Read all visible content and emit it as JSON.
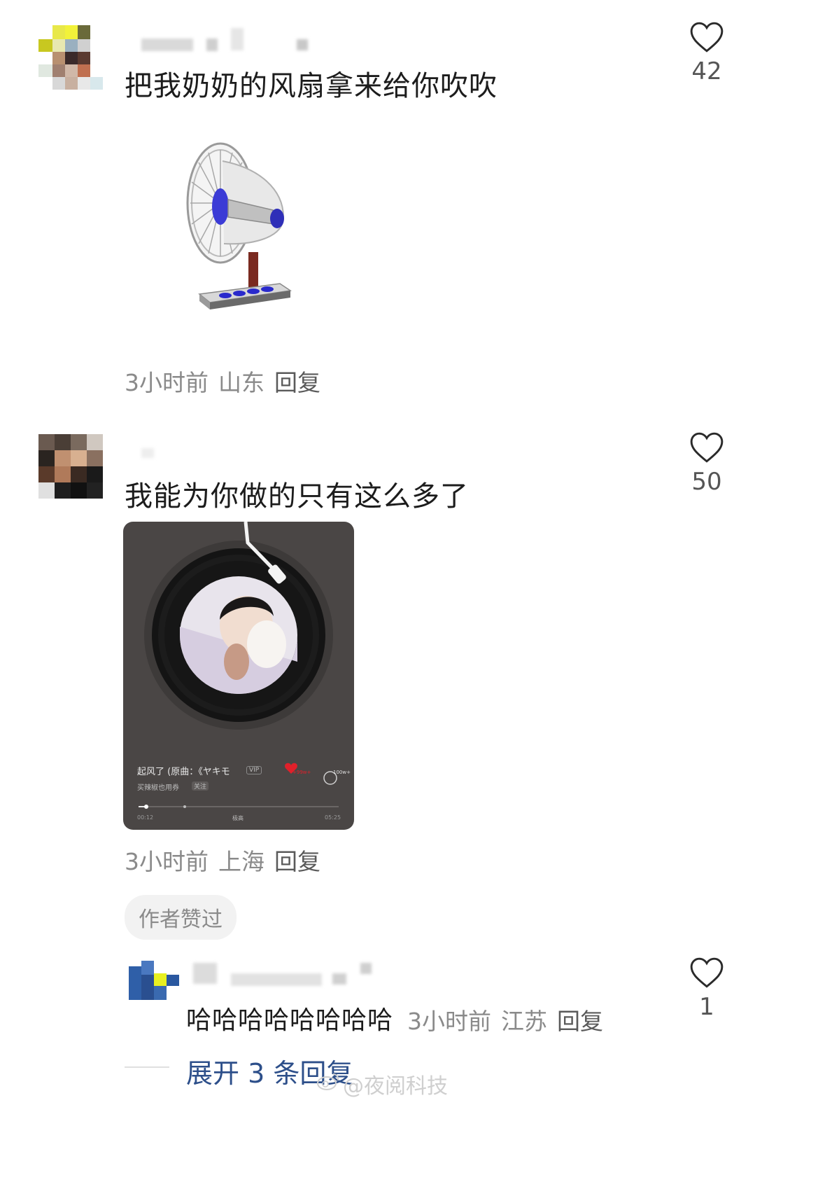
{
  "comments": [
    {
      "text": "把我奶奶的风扇拿来给你吹吹",
      "time": "3小时前",
      "location": "山东",
      "reply_label": "回复",
      "likes": "42"
    },
    {
      "text": "我能为你做的只有这么多了",
      "time": "3小时前",
      "location": "上海",
      "reply_label": "回复",
      "likes": "50",
      "badge": "作者赞过",
      "player": {
        "song_title": "起风了 (原曲：《ヤキモ",
        "vip": "VIP",
        "artist": "买辣椒也用券",
        "follow": "关注",
        "like_count": "+99w+",
        "comment_count": "100w+",
        "time_current": "00:12",
        "quality": "极高",
        "time_total": "05:25"
      }
    }
  ],
  "reply": {
    "text": "哈哈哈哈哈哈哈哈",
    "time": "3小时前",
    "location": "江苏",
    "reply_label": "回复",
    "likes": "1"
  },
  "expand_label": "展开 3 条回复",
  "watermark": "@夜阅科技",
  "icons": {
    "like": "heart-outline-icon",
    "fan": "electric-fan-sticker",
    "player": "vinyl-record-player"
  },
  "colors": {
    "link": "#2d4f8a",
    "meta": "#8a8a8a",
    "player_bg": "#4a4645"
  }
}
